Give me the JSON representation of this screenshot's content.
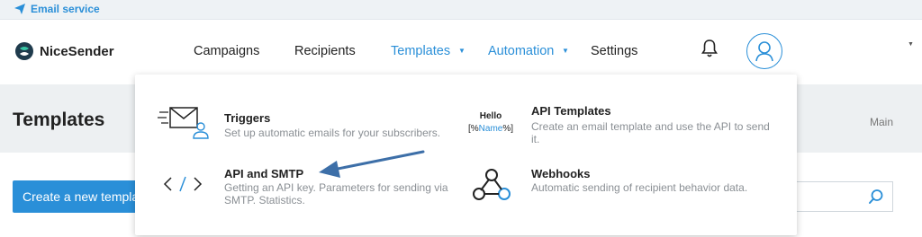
{
  "service": {
    "label": "Email service"
  },
  "header": {
    "brand": "NiceSender",
    "nav": [
      {
        "label": "Campaigns"
      },
      {
        "label": "Recipients"
      },
      {
        "label": "Templates"
      },
      {
        "label": "Automation"
      },
      {
        "label": "Settings"
      }
    ]
  },
  "page": {
    "title": "Templates",
    "breadcrumb": "Main",
    "create_button": "Create a new template",
    "search_placeholder": ""
  },
  "dropdown": {
    "items": [
      {
        "title": "Triggers",
        "description": "Set up automatic emails for your subscribers.",
        "icon": "envelope-person-icon"
      },
      {
        "title": "API Templates",
        "description": "Create an email template and use the API to send it.",
        "icon": "hello-name-icon"
      },
      {
        "title": "API and SMTP",
        "description": "Getting an API key. Parameters for sending via SMTP. Statistics.",
        "icon": "code-brackets-icon"
      },
      {
        "title": "Webhooks",
        "description": "Automatic sending of recipient behavior data.",
        "icon": "webhook-icon"
      }
    ],
    "hello_icon": {
      "line1": "Hello",
      "open": "[%",
      "name": "Name",
      "close": "%]"
    }
  },
  "colors": {
    "accent": "#2a8fd8",
    "arrow": "#3d6fa8"
  }
}
